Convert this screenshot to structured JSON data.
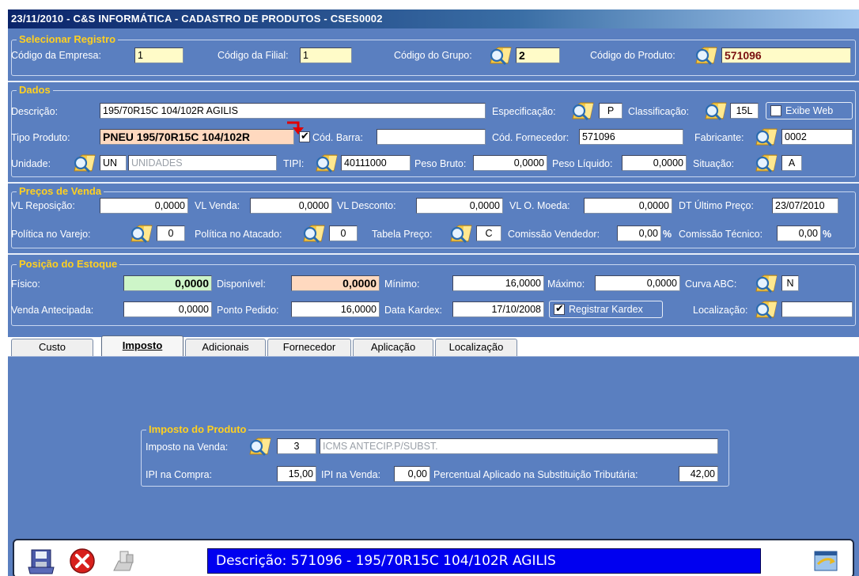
{
  "window": {
    "title": "23/11/2010 - C&S INFORMÁTICA - CADASTRO DE PRODUTOS - CSES0002"
  },
  "selecionar": {
    "title": "Selecionar Registro",
    "empresa_label": "Código da Empresa:",
    "empresa_value": "1",
    "filial_label": "Código da Filial:",
    "filial_value": "1",
    "grupo_label": "Código do Grupo:",
    "grupo_value": "2",
    "produto_label": "Código do Produto:",
    "produto_value": "571096"
  },
  "dados": {
    "title": "Dados",
    "descricao_label": "Descrição:",
    "descricao_value": "195/70R15C 104/102R AGILIS",
    "especificacao_label": "Especificação:",
    "especificacao_value": "P",
    "classificacao_label": "Classificação:",
    "classificacao_value": "15L",
    "exibe_web_label": "Exibe Web",
    "exibe_web_checked": false,
    "tipo_label": "Tipo Produto:",
    "tipo_value": "PNEU 195/70R15C 104/102R",
    "tipo_checked": true,
    "cod_barra_label": "Cód. Barra:",
    "cod_barra_value": "",
    "cod_fornecedor_label": "Cód. Fornecedor:",
    "cod_fornecedor_value": "571096",
    "fabricante_label": "Fabricante:",
    "fabricante_value": "0002",
    "unidade_label": "Unidade:",
    "unidade_code": "UN",
    "unidade_desc": "UNIDADES",
    "tipi_label": "TIPI:",
    "tipi_value": "40111000",
    "peso_bruto_label": "Peso Bruto:",
    "peso_bruto_value": "0,0000",
    "peso_liquido_label": "Peso Líquido:",
    "peso_liquido_value": "0,0000",
    "situacao_label": "Situação:",
    "situacao_value": "A"
  },
  "precos": {
    "title": "Preços de Venda",
    "vl_reposicao_label": "VL Reposição:",
    "vl_reposicao_value": "0,0000",
    "vl_venda_label": "VL Venda:",
    "vl_venda_value": "0,0000",
    "vl_desconto_label": "VL Desconto:",
    "vl_desconto_value": "0,0000",
    "vl_moeda_label": "VL O. Moeda:",
    "vl_moeda_value": "0,0000",
    "dt_ultimo_label": "DT Último Preço:",
    "dt_ultimo_value": "23/07/2010",
    "politica_varejo_label": "Política no Varejo:",
    "politica_varejo_value": "0",
    "politica_atacado_label": "Política no Atacado:",
    "politica_atacado_value": "0",
    "tabela_label": "Tabela Preço:",
    "tabela_value": "C",
    "comissao_vendedor_label": "Comissão Vendedor:",
    "comissao_vendedor_value": "0,00",
    "comissao_tecnico_label": "Comissão Técnico:",
    "comissao_tecnico_value": "0,00",
    "pct_symbol": "%"
  },
  "estoque": {
    "title": "Posição do Estoque",
    "fisico_label": "Físico:",
    "fisico_value": "0,0000",
    "disponivel_label": "Disponível:",
    "disponivel_value": "0,0000",
    "minimo_label": "Mínimo:",
    "minimo_value": "16,0000",
    "maximo_label": "Máximo:",
    "maximo_value": "0,0000",
    "curva_label": "Curva ABC:",
    "curva_value": "N",
    "venda_antecipada_label": "Venda Antecipada:",
    "venda_antecipada_value": "0,0000",
    "ponto_pedido_label": "Ponto Pedido:",
    "ponto_pedido_value": "16,0000",
    "data_kardex_label": "Data Kardex:",
    "data_kardex_value": "17/10/2008",
    "registrar_kardex_label": "Registrar Kardex",
    "registrar_kardex_checked": true,
    "localizacao_label": "Localização:",
    "localizacao_value": ""
  },
  "tabs": [
    {
      "label": "Custo"
    },
    {
      "label": "Imposto"
    },
    {
      "label": "Adicionais"
    },
    {
      "label": "Fornecedor"
    },
    {
      "label": "Aplicação"
    },
    {
      "label": "Localização"
    }
  ],
  "imposto": {
    "title": "Imposto do Produto",
    "imposto_venda_label": "Imposto na Venda:",
    "imposto_venda_code": "3",
    "imposto_venda_desc": "ICMS ANTECIP.P/SUBST.",
    "ipi_compra_label": "IPI na Compra:",
    "ipi_compra_value": "15,00",
    "ipi_venda_label": "IPI na Venda:",
    "ipi_venda_value": "0,00",
    "percentual_label": "Percentual Aplicado na Substituição Tributária:",
    "percentual_value": "42,00"
  },
  "statusbar": {
    "text": "Descrição: 571096 - 195/70R15C 104/102R AGILIS"
  },
  "colors": {
    "client_bg": "#5a7fc0",
    "group_title": "#ffd020",
    "status_bg": "#0000f0"
  }
}
